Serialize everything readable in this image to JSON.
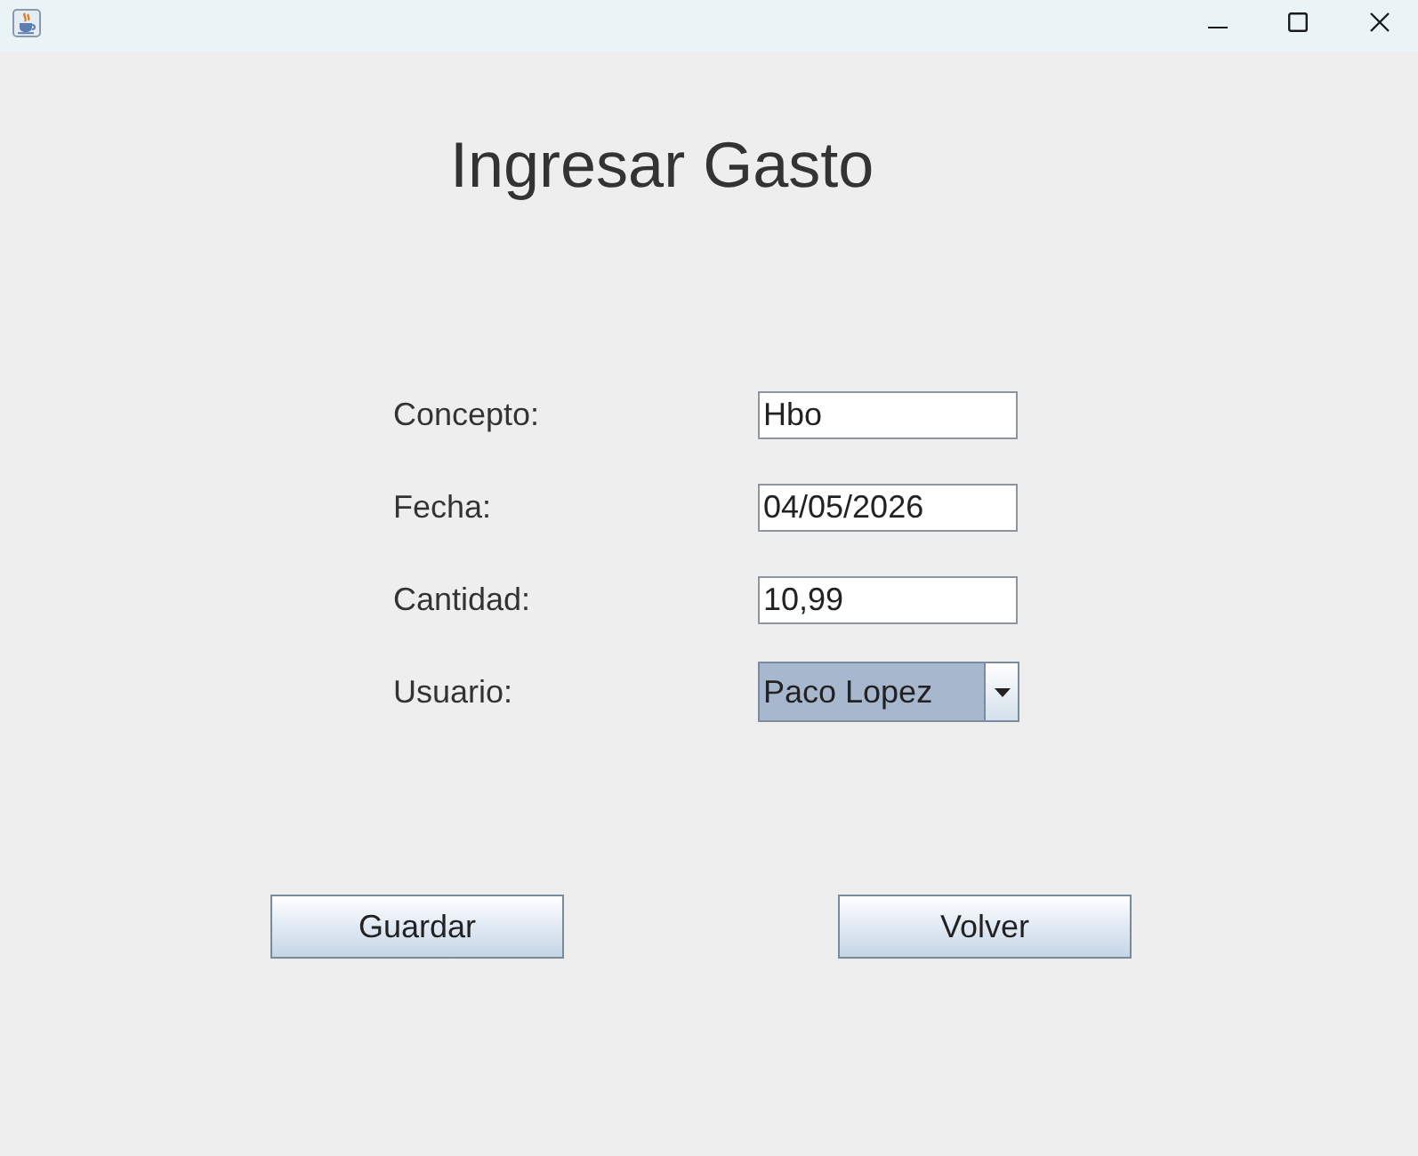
{
  "heading": "Ingresar Gasto",
  "form": {
    "fields": [
      {
        "label": "Concepto:",
        "kind": "text",
        "value": "Hbo",
        "focused": false
      },
      {
        "label": "Fecha:",
        "kind": "text",
        "value": "04/05/2026",
        "focused": false
      },
      {
        "label": "Cantidad:",
        "kind": "text",
        "value": "10,99",
        "focused": false
      },
      {
        "label": "Usuario:",
        "kind": "dropdown",
        "value": "Paco Lopez",
        "focused": true
      }
    ]
  },
  "buttons": [
    "Guardar",
    "Volver"
  ]
}
